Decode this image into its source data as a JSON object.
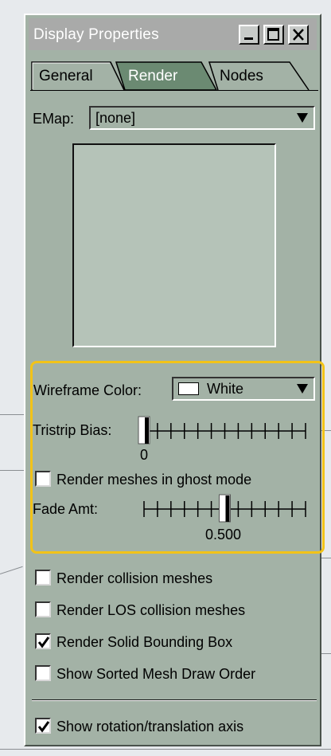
{
  "window": {
    "title": "Display Properties",
    "controls": [
      "minimize",
      "maximize",
      "close"
    ]
  },
  "tabs": [
    {
      "label": "General",
      "selected": false
    },
    {
      "label": "Render",
      "selected": true
    },
    {
      "label": "Nodes",
      "selected": false
    }
  ],
  "emap": {
    "label": "EMap:",
    "value": "[none]"
  },
  "wireframe": {
    "label": "Wireframe Color:",
    "value": "White",
    "swatch_color": "#ffffff"
  },
  "tristrip": {
    "label": "Tristrip Bias:",
    "value_text": "0",
    "position": 0.0
  },
  "ghost_mode": {
    "label": "Render meshes in ghost mode",
    "checked": false
  },
  "fade": {
    "label": "Fade Amt:",
    "value_text": "0.500",
    "position": 0.5
  },
  "options": [
    {
      "label": "Render collision meshes",
      "checked": false
    },
    {
      "label": "Render LOS collision meshes",
      "checked": false
    },
    {
      "label": "Render Solid Bounding Box",
      "checked": true
    },
    {
      "label": "Show Sorted Mesh Draw Order",
      "checked": false
    }
  ],
  "axis_option": {
    "label": "Show rotation/translation axis",
    "checked": true
  },
  "colors": {
    "panel": "#a3b2a6",
    "selected_tab": "#6b8a72",
    "highlight": "#f2c318",
    "titlebar": "#a9aaa9"
  }
}
